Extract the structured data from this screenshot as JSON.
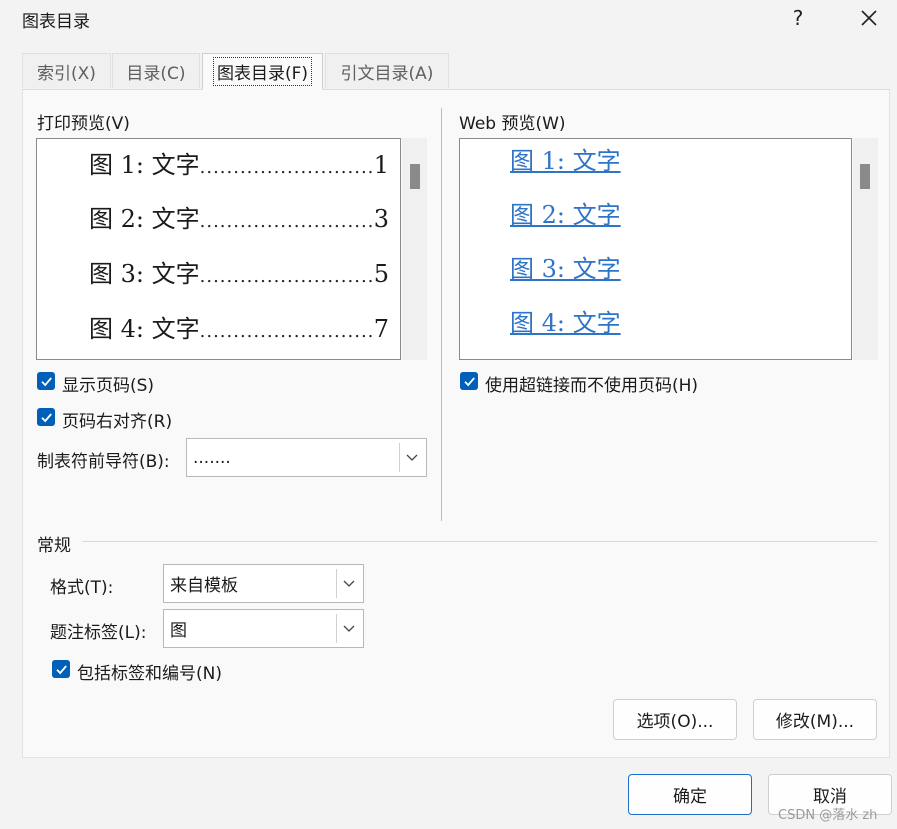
{
  "window": {
    "title": "图表目录",
    "help_label": "?",
    "close_label": "×"
  },
  "tabs": [
    {
      "label": "索引(X)"
    },
    {
      "label": "目录(C)"
    },
    {
      "label": "图表目录(F)"
    },
    {
      "label": "引文目录(A)"
    }
  ],
  "print_preview": {
    "label": "打印预览(V)",
    "rows": [
      {
        "text": "图 1: 文字",
        "page": "1"
      },
      {
        "text": "图 2: 文字",
        "page": "3"
      },
      {
        "text": "图 3: 文字",
        "page": "5"
      },
      {
        "text": "图 4: 文字",
        "page": "7"
      }
    ],
    "dots": "......................................................"
  },
  "web_preview": {
    "label": "Web 预览(W)",
    "rows": [
      "图 1: 文字",
      "图 2: 文字",
      "图 3: 文字",
      "图 4: 文字"
    ]
  },
  "options": {
    "show_page_numbers": {
      "label": "显示页码(S)",
      "checked": true
    },
    "right_align": {
      "label": "页码右对齐(R)",
      "checked": true
    },
    "tab_leader": {
      "label": "制表符前导符(B):",
      "value": "......."
    },
    "use_hyperlinks": {
      "label": "使用超链接而不使用页码(H)",
      "checked": true
    }
  },
  "general": {
    "heading": "常规",
    "format": {
      "label": "格式(T):",
      "value": "来自模板"
    },
    "caption_label": {
      "label": "题注标签(L):",
      "value": "图"
    },
    "include_label": {
      "label": "包括标签和编号(N)",
      "checked": true
    }
  },
  "buttons": {
    "options": "选项(O)...",
    "modify": "修改(M)...",
    "ok": "确定",
    "cancel": "取消"
  },
  "watermark": "CSDN @落水 zh",
  "colors": {
    "accent": "#005fb8",
    "link": "#2e74c7"
  }
}
